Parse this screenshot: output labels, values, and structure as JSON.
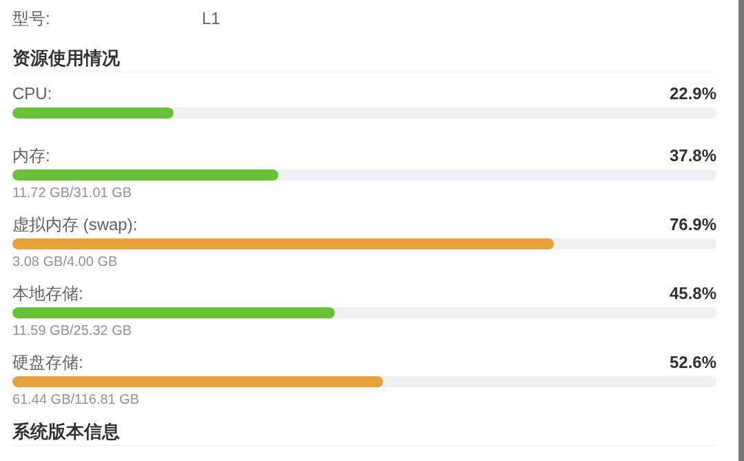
{
  "model": {
    "label": "型号:",
    "value": "L1"
  },
  "resource_usage": {
    "title": "资源使用情况",
    "items": [
      {
        "label": "CPU:",
        "percent": "22.9%",
        "level": 0.229,
        "color": "#67c23a"
      },
      {
        "label": "内存:",
        "percent": "37.8%",
        "level": 0.378,
        "color": "#67c23a",
        "usage": "11.72 GB/31.01 GB"
      },
      {
        "label": "虚拟内存 (swap):",
        "percent": "76.9%",
        "level": 0.769,
        "color": "#e6a23c",
        "usage": "3.08 GB/4.00 GB"
      },
      {
        "label": "本地存储:",
        "percent": "45.8%",
        "level": 0.458,
        "color": "#67c23a",
        "usage": "11.59 GB/25.32 GB"
      },
      {
        "label": "硬盘存储:",
        "percent": "52.6%",
        "level": 0.526,
        "color": "#e6a23c",
        "usage": "61.44 GB/116.81 GB"
      }
    ]
  },
  "system_version": {
    "title": "系统版本信息"
  }
}
